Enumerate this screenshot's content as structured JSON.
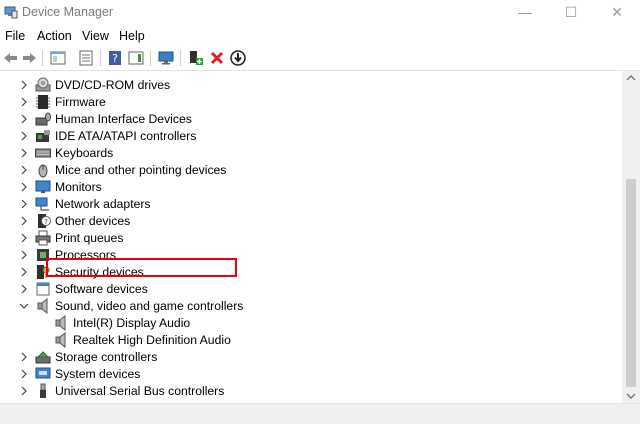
{
  "window": {
    "title": "Device Manager",
    "controls": {
      "minimize": "—",
      "maximize": "☐",
      "close": "✕"
    }
  },
  "menu": [
    "File",
    "Action",
    "View",
    "Help"
  ],
  "toolbar": {
    "buttons": [
      "back-icon",
      "forward-icon",
      "properties-pane-icon",
      "device-list-icon",
      "help-icon",
      "action-pane-icon",
      "monitor-scan-icon",
      "update-driver-icon",
      "uninstall-icon",
      "disable-icon"
    ]
  },
  "tree": {
    "items": [
      {
        "label": "DVD/CD-ROM drives",
        "icon": "dvd-drive-icon",
        "expanded": false
      },
      {
        "label": "Firmware",
        "icon": "firmware-icon",
        "expanded": false
      },
      {
        "label": "Human Interface Devices",
        "icon": "hid-icon",
        "expanded": false
      },
      {
        "label": "IDE ATA/ATAPI controllers",
        "icon": "ide-controller-icon",
        "expanded": false
      },
      {
        "label": "Keyboards",
        "icon": "keyboard-icon",
        "expanded": false
      },
      {
        "label": "Mice and other pointing devices",
        "icon": "mouse-icon",
        "expanded": false
      },
      {
        "label": "Monitors",
        "icon": "monitor-icon",
        "expanded": false
      },
      {
        "label": "Network adapters",
        "icon": "network-adapter-icon",
        "expanded": false
      },
      {
        "label": "Other devices",
        "icon": "other-devices-icon",
        "expanded": false
      },
      {
        "label": "Print queues",
        "icon": "printer-icon",
        "expanded": false
      },
      {
        "label": "Processors",
        "icon": "processor-icon",
        "expanded": false
      },
      {
        "label": "Security devices",
        "icon": "security-device-icon",
        "expanded": false
      },
      {
        "label": "Software devices",
        "icon": "software-device-icon",
        "expanded": false
      },
      {
        "label": "Sound, video and game controllers",
        "icon": "speaker-icon",
        "expanded": true
      },
      {
        "label": "Intel(R) Display Audio",
        "icon": "speaker-icon",
        "child": true
      },
      {
        "label": "Realtek High Definition Audio",
        "icon": "speaker-icon",
        "child": true,
        "highlighted": true
      },
      {
        "label": "Storage controllers",
        "icon": "storage-controller-icon",
        "expanded": false
      },
      {
        "label": "System devices",
        "icon": "system-device-icon",
        "expanded": false
      },
      {
        "label": "Universal Serial Bus controllers",
        "icon": "usb-icon",
        "expanded": false
      }
    ]
  },
  "colors": {
    "highlight_border": "#e8000d",
    "accent": "#0078d7"
  }
}
